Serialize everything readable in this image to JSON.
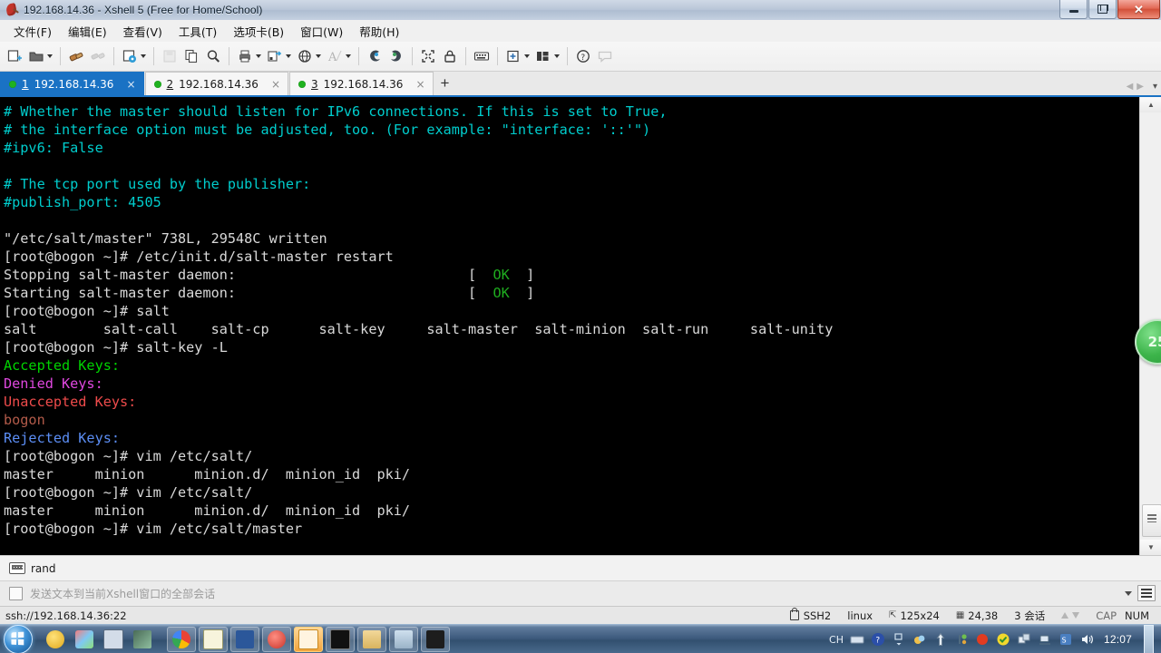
{
  "window": {
    "title": "192.168.14.36 - Xshell 5 (Free for Home/School)",
    "app_icon": "xshell-feather-icon",
    "minimize_label": "—",
    "maximize_label": "❐",
    "close_label": "✕"
  },
  "menubar": {
    "items": [
      {
        "label": "文件(F)",
        "name": "menu-file"
      },
      {
        "label": "编辑(E)",
        "name": "menu-edit"
      },
      {
        "label": "查看(V)",
        "name": "menu-view"
      },
      {
        "label": "工具(T)",
        "name": "menu-tools"
      },
      {
        "label": "选项卡(B)",
        "name": "menu-tabs"
      },
      {
        "label": "窗口(W)",
        "name": "menu-window"
      },
      {
        "label": "帮助(H)",
        "name": "menu-help"
      }
    ]
  },
  "toolbar": {
    "buttons": [
      {
        "name": "new-session-icon",
        "has_caret": false
      },
      {
        "name": "open-folder-icon",
        "has_caret": true
      },
      {
        "name": "connect-icon",
        "has_caret": false
      },
      {
        "name": "disconnect-icon",
        "has_caret": false
      },
      {
        "name": "session-properties-icon",
        "has_caret": true
      },
      {
        "name": "save-icon",
        "has_caret": false
      },
      {
        "name": "copy-icon",
        "has_caret": false
      },
      {
        "name": "find-icon",
        "has_caret": false
      },
      {
        "name": "print-icon",
        "has_caret": true
      },
      {
        "name": "file-transfer-icon",
        "has_caret": true
      },
      {
        "name": "globe-icon",
        "has_caret": true
      },
      {
        "name": "font-icon",
        "has_caret": true
      },
      {
        "name": "ssh-tunnel-icon",
        "has_caret": false
      },
      {
        "name": "ssh-forward-icon",
        "has_caret": false
      },
      {
        "name": "fullscreen-icon",
        "has_caret": false
      },
      {
        "name": "lock-icon",
        "has_caret": false
      },
      {
        "name": "keyboard-icon",
        "has_caret": false
      },
      {
        "name": "add-panel-icon",
        "has_caret": true
      },
      {
        "name": "layout-icon",
        "has_caret": true
      },
      {
        "name": "help-icon",
        "has_caret": false
      },
      {
        "name": "chat-icon",
        "has_caret": false
      }
    ]
  },
  "tabs": {
    "items": [
      {
        "num": "1",
        "label": "192.168.14.36",
        "active": true,
        "status": "connected",
        "close": "×"
      },
      {
        "num": "2",
        "label": "192.168.14.36",
        "active": false,
        "status": "connected",
        "close": "×"
      },
      {
        "num": "3",
        "label": "192.168.14.36",
        "active": false,
        "status": "connected",
        "close": "×"
      }
    ],
    "add_label": "+",
    "scroll_left": "◀",
    "scroll_right": "▶",
    "list_label": "▾"
  },
  "terminal": {
    "lines": [
      {
        "segments": [
          {
            "t": "# Whether the master should listen for IPv6 connections. If this is set to True,",
            "c": "c-cyan"
          }
        ]
      },
      {
        "segments": [
          {
            "t": "# the interface option must be adjusted, too. (For example: \"interface: '::'\")",
            "c": "c-cyan"
          }
        ]
      },
      {
        "segments": [
          {
            "t": "#ipv6: False",
            "c": "c-cyan"
          }
        ]
      },
      {
        "segments": [
          {
            "t": " ",
            "c": "c-white"
          }
        ]
      },
      {
        "segments": [
          {
            "t": "# The tcp port used by the publisher:",
            "c": "c-cyan"
          }
        ]
      },
      {
        "segments": [
          {
            "t": "#publish_port: 4505",
            "c": "c-cyan"
          }
        ]
      },
      {
        "segments": [
          {
            "t": " ",
            "c": "c-white"
          }
        ]
      },
      {
        "segments": [
          {
            "t": "\"/etc/salt/master\" 738L, 29548C written",
            "c": "c-white"
          }
        ]
      },
      {
        "segments": [
          {
            "t": "[root@bogon ~]# /etc/init.d/salt-master restart",
            "c": "c-white"
          }
        ]
      },
      {
        "segments": [
          {
            "t": "Stopping salt-master daemon:                            [  ",
            "c": "c-white"
          },
          {
            "t": "OK",
            "c": "c-green2"
          },
          {
            "t": "  ]",
            "c": "c-white"
          }
        ]
      },
      {
        "segments": [
          {
            "t": "Starting salt-master daemon:                            [  ",
            "c": "c-white"
          },
          {
            "t": "OK",
            "c": "c-green2"
          },
          {
            "t": "  ]",
            "c": "c-white"
          }
        ]
      },
      {
        "segments": [
          {
            "t": "[root@bogon ~]# salt",
            "c": "c-white"
          }
        ]
      },
      {
        "segments": [
          {
            "t": "salt        salt-call    salt-cp      salt-key     salt-master  salt-minion  salt-run     salt-unity",
            "c": "c-white"
          }
        ]
      },
      {
        "segments": [
          {
            "t": "[root@bogon ~]# salt-key -L",
            "c": "c-white"
          }
        ]
      },
      {
        "segments": [
          {
            "t": "Accepted Keys:",
            "c": "c-green"
          }
        ]
      },
      {
        "segments": [
          {
            "t": "Denied Keys:",
            "c": "c-magenta"
          }
        ]
      },
      {
        "segments": [
          {
            "t": "Unaccepted Keys:",
            "c": "c-red"
          }
        ]
      },
      {
        "segments": [
          {
            "t": "bogon",
            "c": "c-dimred"
          }
        ]
      },
      {
        "segments": [
          {
            "t": "Rejected Keys:",
            "c": "c-blue"
          }
        ]
      },
      {
        "segments": [
          {
            "t": "[root@bogon ~]# vim /etc/salt/",
            "c": "c-white"
          }
        ]
      },
      {
        "segments": [
          {
            "t": "master     minion      minion.d/  minion_id  pki/",
            "c": "c-white"
          }
        ]
      },
      {
        "segments": [
          {
            "t": "[root@bogon ~]# vim /etc/salt/",
            "c": "c-white"
          }
        ]
      },
      {
        "segments": [
          {
            "t": "master     minion      minion.d/  minion_id  pki/",
            "c": "c-white"
          }
        ]
      },
      {
        "segments": [
          {
            "t": "[root@bogon ~]# vim /etc/salt/master",
            "c": "c-white"
          }
        ]
      }
    ]
  },
  "watermark": {
    "label": "25"
  },
  "rand_bar": {
    "icon": "keyboard-icon",
    "label": "rand"
  },
  "send_bar": {
    "checkbox_checked": false,
    "label": "发送文本到当前Xshell窗口的全部会话",
    "dropdown_icon": "chevron-down-icon",
    "menu_icon": "list-menu-icon"
  },
  "statusbar": {
    "connection": "ssh://192.168.14.36:22",
    "security": "SSH2",
    "terminal_type": "linux",
    "size": "125x24",
    "cursor": "24,38",
    "sessions": "3 会话",
    "cap": "CAP",
    "num": "NUM"
  },
  "taskbar": {
    "start_name": "start-orb",
    "quicklaunch": [
      {
        "name": "taskbar-icon-media",
        "color": "#f2c31a"
      },
      {
        "name": "taskbar-icon-paint",
        "color": "#9ccfe8"
      },
      {
        "name": "taskbar-icon-save",
        "color": "#c8d4e2"
      },
      {
        "name": "taskbar-icon-tool",
        "color": "#4a6b57"
      }
    ],
    "tasks": [
      {
        "name": "taskbar-app-chrome",
        "color": "#3aa757",
        "active": false
      },
      {
        "name": "taskbar-app-notepad",
        "color": "#f5f2d0",
        "active": false
      },
      {
        "name": "taskbar-app-word",
        "color": "#2b579a",
        "active": false
      },
      {
        "name": "taskbar-app-editplus",
        "color": "#d8453a",
        "active": false
      },
      {
        "name": "taskbar-app-xshell",
        "color": "#f39c2c",
        "active": true
      },
      {
        "name": "taskbar-app-cmd",
        "color": "#1a1a1a",
        "active": false
      },
      {
        "name": "taskbar-app-explorer",
        "color": "#e5c77a",
        "active": false
      },
      {
        "name": "taskbar-app-photo",
        "color": "#b9c9d8",
        "active": false
      },
      {
        "name": "taskbar-app-pycharm",
        "color": "#222222",
        "active": false
      }
    ],
    "tray": {
      "ime": "CH",
      "icons": [
        {
          "name": "tray-keyboard-icon"
        },
        {
          "name": "tray-help-icon"
        },
        {
          "name": "tray-expand-icon"
        },
        {
          "name": "tray-cloud-icon"
        },
        {
          "name": "tray-update-icon"
        },
        {
          "name": "tray-tools-icon"
        },
        {
          "name": "tray-record-icon"
        },
        {
          "name": "tray-shield-icon"
        },
        {
          "name": "tray-share-icon"
        },
        {
          "name": "tray-network-icon"
        },
        {
          "name": "tray-ime-icon"
        },
        {
          "name": "tray-volume-icon"
        }
      ],
      "clock": "12:07"
    }
  }
}
